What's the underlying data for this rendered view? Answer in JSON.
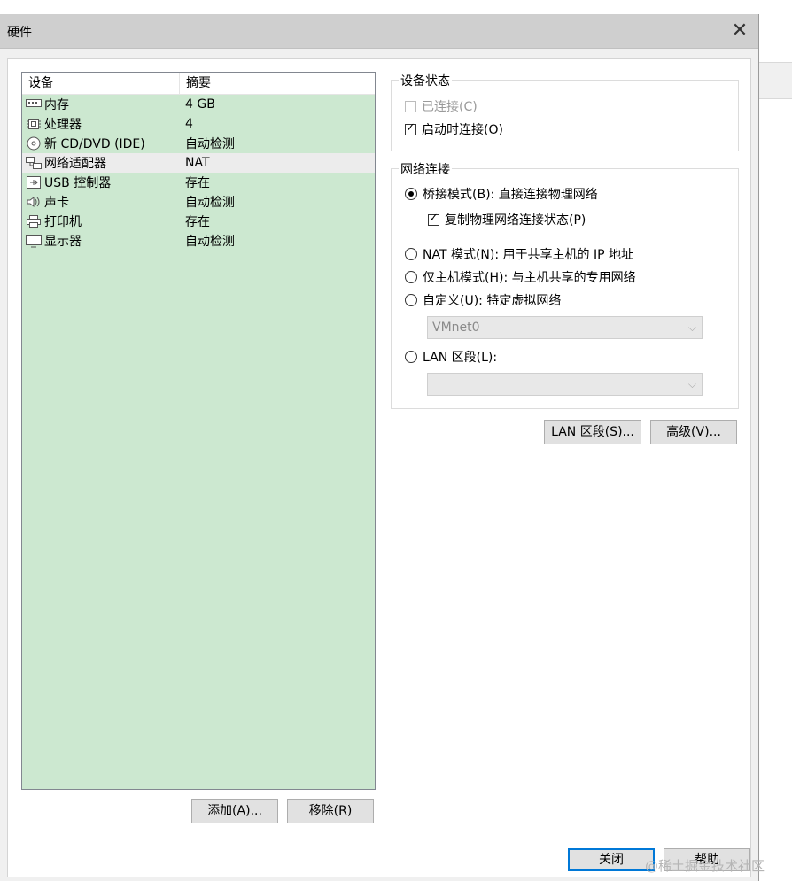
{
  "window": {
    "title": "硬件",
    "close_glyph": "✕"
  },
  "device_list": {
    "headers": [
      "设备",
      "摘要"
    ],
    "rows": [
      {
        "icon": "memory-icon",
        "device": "内存",
        "summary": "4 GB"
      },
      {
        "icon": "processor-icon",
        "device": "处理器",
        "summary": "4"
      },
      {
        "icon": "cd-dvd-icon",
        "device": "新 CD/DVD (IDE)",
        "summary": "自动检测"
      },
      {
        "icon": "network-adapter-icon",
        "device": "网络适配器",
        "summary": "NAT"
      },
      {
        "icon": "usb-icon",
        "device": "USB 控制器",
        "summary": "存在"
      },
      {
        "icon": "sound-icon",
        "device": "声卡",
        "summary": "自动检测"
      },
      {
        "icon": "printer-icon",
        "device": "打印机",
        "summary": "存在"
      },
      {
        "icon": "display-icon",
        "device": "显示器",
        "summary": "自动检测"
      }
    ],
    "selected_index": 3,
    "add_button": "添加(A)...",
    "remove_button": "移除(R)"
  },
  "device_status": {
    "legend": "设备状态",
    "connected": {
      "label": "已连接(C)",
      "checked": false,
      "enabled": false
    },
    "connect_at_power_on": {
      "label": "启动时连接(O)",
      "checked": true
    }
  },
  "network_connection": {
    "legend": "网络连接",
    "bridged": {
      "label": "桥接模式(B): 直接连接物理网络",
      "selected": true
    },
    "replicate": {
      "label": "复制物理网络连接状态(P)",
      "checked": true
    },
    "nat": {
      "label": "NAT 模式(N): 用于共享主机的 IP 地址"
    },
    "host_only": {
      "label": "仅主机模式(H): 与主机共享的专用网络"
    },
    "custom": {
      "label": "自定义(U): 特定虚拟网络"
    },
    "custom_select_value": "VMnet0",
    "lan_segment": {
      "label": "LAN 区段(L):"
    },
    "lan_select_value": ""
  },
  "buttons": {
    "lan_segments": "LAN 区段(S)...",
    "advanced": "高级(V)...",
    "close": "关闭",
    "help": "帮助"
  },
  "watermark": "@稀土掘金技术社区"
}
